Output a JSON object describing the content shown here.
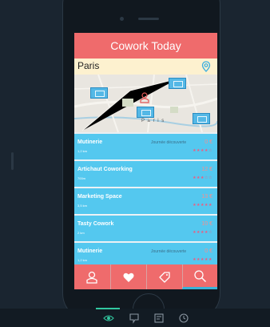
{
  "app": {
    "title": "Cowork Today",
    "search_value": "Paris"
  },
  "map": {
    "city_label": "P a r i s"
  },
  "listings": [
    {
      "name": "Mutinerie",
      "distance": "1,2 km",
      "note": "Journée découverte",
      "price": "0 €",
      "rating": "★★★★☆"
    },
    {
      "name": "Artichaut Coworking",
      "distance": "700m",
      "note": "",
      "price": "12 €",
      "rating": "★★★☆☆"
    },
    {
      "name": "Marketing Space",
      "distance": "3,5 km",
      "note": "",
      "price": "13 €",
      "rating": "★★★★★"
    },
    {
      "name": "Tasty Cowork",
      "distance": "2 km",
      "note": "",
      "price": "10 €",
      "rating": "★★★★☆"
    },
    {
      "name": "Mutinerie",
      "distance": "1,2 km",
      "note": "Journée découverte",
      "price": "0 €",
      "rating": "★★★★★"
    }
  ],
  "tabs": [
    {
      "icon": "profile-icon",
      "active": false
    },
    {
      "icon": "heart-icon",
      "active": false
    },
    {
      "icon": "tag-icon",
      "active": false
    },
    {
      "icon": "search-icon",
      "active": true
    }
  ],
  "toolbar_icons": [
    "eye-icon",
    "comment-icon",
    "notes-icon",
    "clock-icon"
  ],
  "colors": {
    "header": "#ef6b6c",
    "search_bar": "#fdf1cf",
    "list_item": "#54c8ef",
    "price": "#f58f8f",
    "rating": "#f05a7e",
    "active_tab_underline": "#3bb2d8"
  }
}
